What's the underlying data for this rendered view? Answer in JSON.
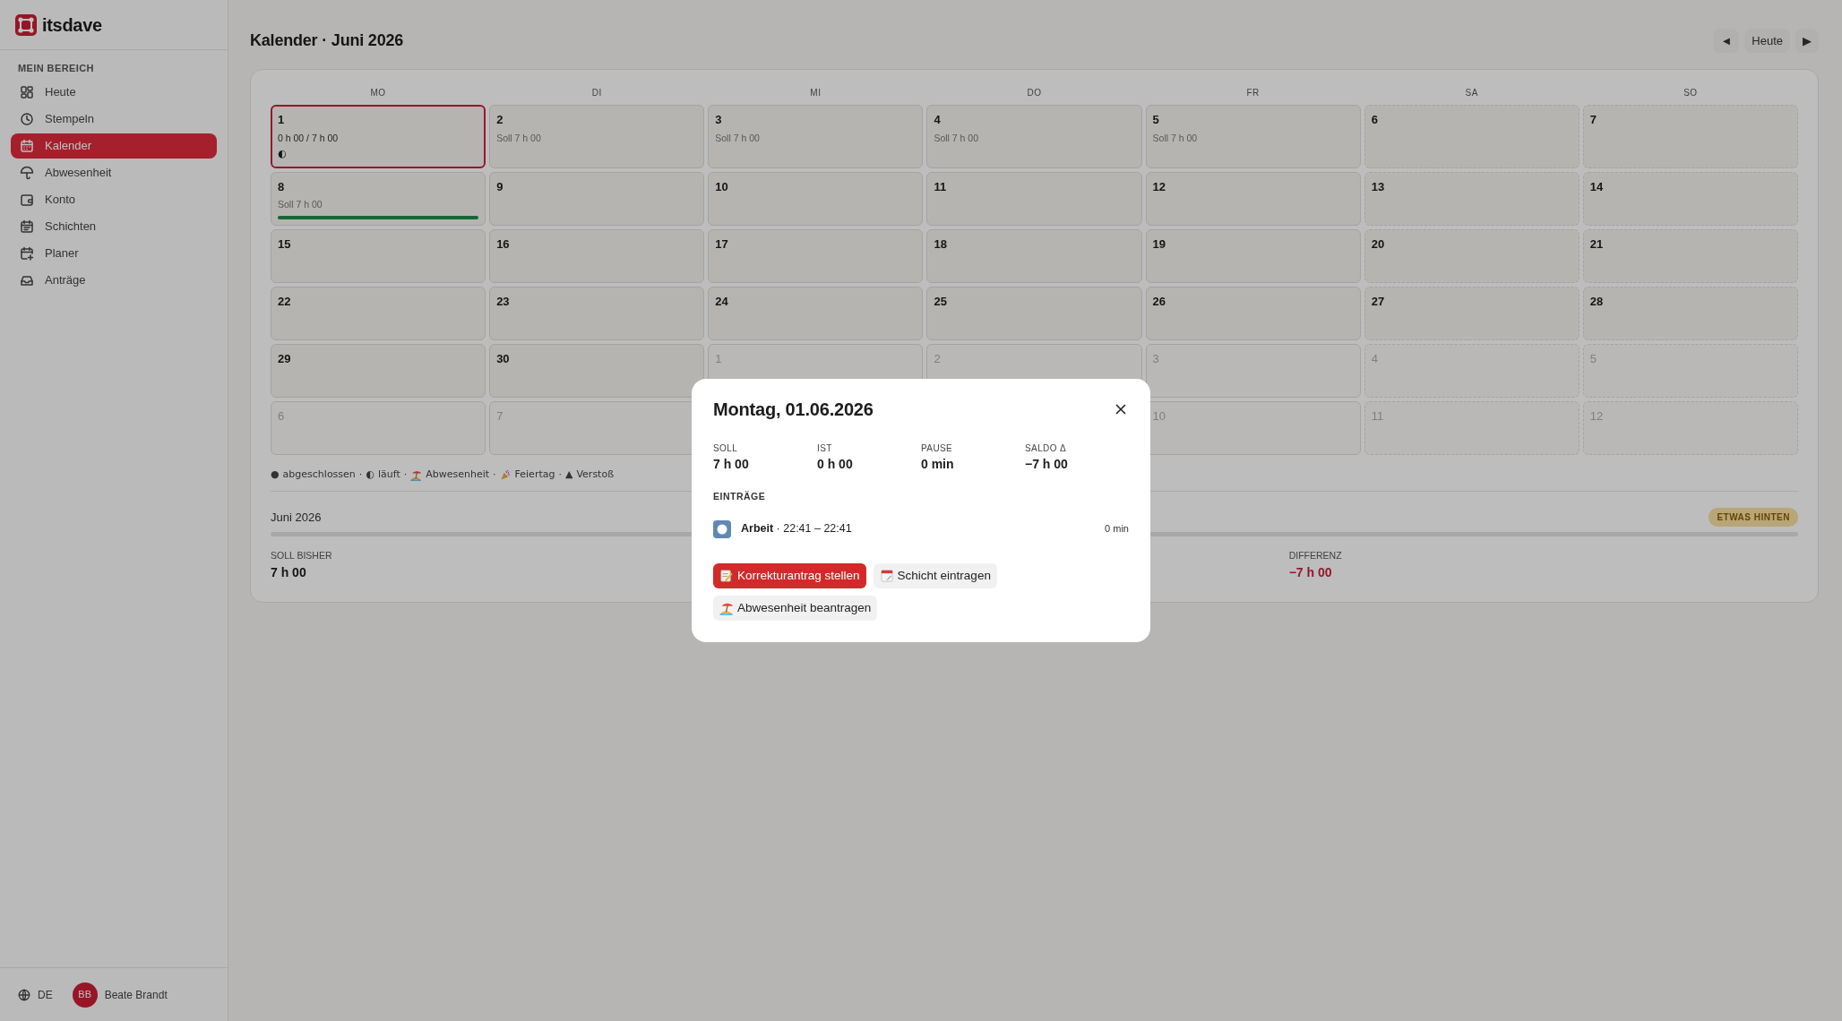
{
  "sidebar": {
    "brand": "itsdave",
    "section": "MEIN BEREICH",
    "items": [
      {
        "label": "Heute",
        "selected": false
      },
      {
        "label": "Stempeln",
        "selected": false
      },
      {
        "label": "Kalender",
        "selected": true
      },
      {
        "label": "Abwesenheit",
        "selected": false
      },
      {
        "label": "Konto",
        "selected": false
      },
      {
        "label": "Schichten",
        "selected": false
      },
      {
        "label": "Planer",
        "selected": false
      },
      {
        "label": "Anträge",
        "selected": false
      }
    ],
    "language": "DE",
    "user": {
      "initials": "BB",
      "name": "Beate Brandt"
    }
  },
  "header": {
    "title": "Kalender · Juni 2026",
    "prev": "◄",
    "today": "Heute",
    "next": "▶"
  },
  "calendar": {
    "weekdays": [
      "MO",
      "DI",
      "MI",
      "DO",
      "FR",
      "SA",
      "SO"
    ],
    "weeks": [
      [
        {
          "day": "1",
          "selected": true,
          "note": "0 h 00 / 7 h 00",
          "status": "◐"
        },
        {
          "day": "2",
          "selected": false,
          "note": "Soll 7 h 00"
        },
        {
          "day": "3",
          "selected": false,
          "note": "Soll 7 h 00"
        },
        {
          "day": "4",
          "selected": false,
          "note": "Soll 7 h 00"
        },
        {
          "day": "5",
          "selected": false,
          "note": "Soll 7 h 00"
        },
        {
          "day": "6",
          "selected": false,
          "weekend": true
        },
        {
          "day": "7",
          "selected": false,
          "weekend": true
        }
      ],
      [
        {
          "day": "8",
          "selected": false,
          "note": "Soll 7 h 00",
          "level": 1
        },
        {
          "day": "9",
          "selected": false
        },
        {
          "day": "10",
          "selected": false
        },
        {
          "day": "11",
          "selected": false
        },
        {
          "day": "12",
          "selected": false
        },
        {
          "day": "13",
          "selected": false,
          "weekend": true
        },
        {
          "day": "14",
          "selected": false,
          "weekend": true
        }
      ],
      [
        {
          "day": "15",
          "selected": false
        },
        {
          "day": "16",
          "selected": false
        },
        {
          "day": "17",
          "selected": false
        },
        {
          "day": "18",
          "selected": false
        },
        {
          "day": "19",
          "selected": false
        },
        {
          "day": "20",
          "selected": false,
          "weekend": true
        },
        {
          "day": "21",
          "selected": false,
          "weekend": true
        }
      ],
      [
        {
          "day": "22",
          "selected": false
        },
        {
          "day": "23",
          "selected": false
        },
        {
          "day": "24",
          "selected": false
        },
        {
          "day": "25",
          "selected": false
        },
        {
          "day": "26",
          "selected": false
        },
        {
          "day": "27",
          "selected": false,
          "weekend": true
        },
        {
          "day": "28",
          "selected": false,
          "weekend": true
        }
      ],
      [
        {
          "day": "29",
          "selected": false
        },
        {
          "day": "30",
          "selected": false
        },
        {
          "day": "1",
          "selected": false,
          "muted": true
        },
        {
          "day": "2",
          "selected": false,
          "muted": true
        },
        {
          "day": "3",
          "selected": false,
          "muted": true
        },
        {
          "day": "4",
          "selected": false,
          "muted": true,
          "weekend": true
        },
        {
          "day": "5",
          "selected": false,
          "muted": true,
          "weekend": true
        }
      ],
      [
        {
          "day": "6",
          "selected": false,
          "muted": true
        },
        {
          "day": "7",
          "selected": false,
          "muted": true
        },
        {
          "day": "10",
          "selected": false,
          "muted": true
        },
        {
          "day": "11",
          "selected": false,
          "muted": true,
          "weekend": true
        },
        {
          "day": "12",
          "selected": false,
          "muted": true,
          "weekend": true
        }
      ]
    ],
    "legend": {
      "separator": "·",
      "items": [
        {
          "kind": "glyph",
          "symbol": "●",
          "label": "abgeschlossen"
        },
        {
          "kind": "glyph",
          "symbol": "◐",
          "label": "läuft"
        },
        {
          "kind": "beach",
          "label": "Abwesenheit"
        },
        {
          "kind": "party",
          "label": "Feiertag"
        },
        {
          "kind": "glyph",
          "symbol": "▲",
          "label": "Verstoß"
        }
      ]
    }
  },
  "summary": {
    "month": "Juni 2026",
    "badge": "ETWAS HINTEN",
    "level": 0,
    "stats": [
      {
        "label": "SOLL BISHER",
        "value": "7 h 00",
        "negative": false
      },
      {
        "label": "DIFFERENZ",
        "value": "−7 h 00",
        "negative": true
      }
    ]
  },
  "dialog": {
    "title": "Montag, 01.06.2026",
    "stats": [
      {
        "label": "SOLL",
        "value": "7 h 00"
      },
      {
        "label": "IST",
        "value": "0 h 00"
      },
      {
        "label": "PAUSE",
        "value": "0 min"
      },
      {
        "label": "SALDO Δ",
        "value": "−7 h 00"
      }
    ],
    "entries_title": "EINTRÄGE",
    "entries": [
      {
        "text": "**Arbeit** · 22:41 – 22:41",
        "duration": "0 min"
      }
    ],
    "actions": [
      {
        "kind": "primary",
        "label": "Korrekturantrag stellen"
      },
      {
        "kind": "secondary",
        "label": "Schicht eintragen"
      },
      {
        "kind": "secondary",
        "label": "Abwesenheit beantragen"
      }
    ]
  }
}
